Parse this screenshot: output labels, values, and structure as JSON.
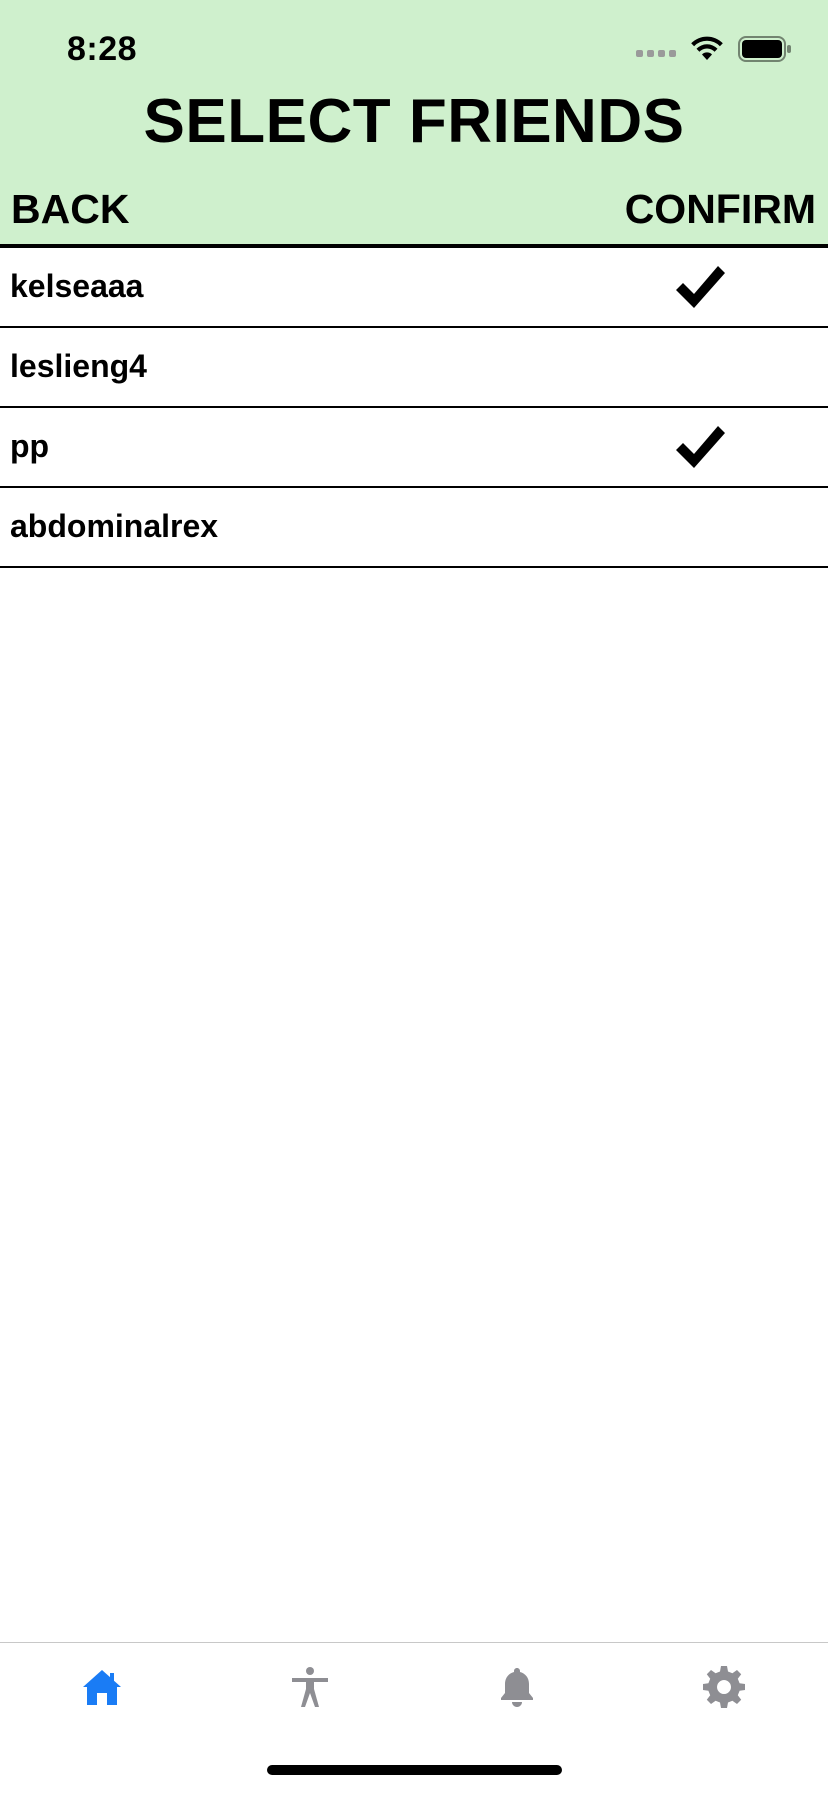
{
  "status_bar": {
    "time": "8:28"
  },
  "header": {
    "title": "SELECT FRIENDS",
    "back_label": "BACK",
    "confirm_label": "CONFIRM",
    "background_color": "#cff0cd"
  },
  "friends": [
    {
      "name": "kelseaaa",
      "selected": true
    },
    {
      "name": "leslieng4",
      "selected": false
    },
    {
      "name": "pp",
      "selected": true
    },
    {
      "name": "abdominalrex",
      "selected": false
    }
  ],
  "tab_bar": {
    "active_color": "#1a7cf5",
    "inactive_color": "#8e8e93",
    "tabs": [
      {
        "icon": "home-icon",
        "active": true
      },
      {
        "icon": "person-icon",
        "active": false
      },
      {
        "icon": "bell-icon",
        "active": false
      },
      {
        "icon": "gear-icon",
        "active": false
      }
    ]
  }
}
